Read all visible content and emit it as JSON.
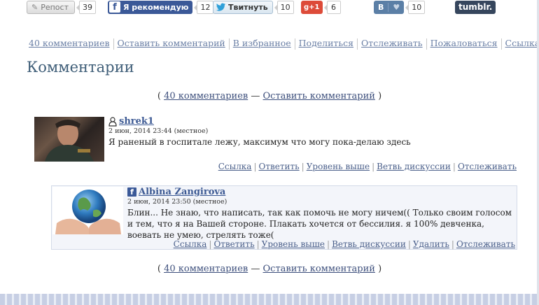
{
  "share_bar": {
    "repost": {
      "label": "Репост",
      "count": "39"
    },
    "facebook": {
      "icon": "f",
      "label": "Я рекомендую",
      "count": "12"
    },
    "twitter": {
      "label": "Твитнуть",
      "count": "10"
    },
    "gplus": {
      "label": "g+1",
      "count": "6"
    },
    "vk": {
      "icon": "В",
      "heart": "♥",
      "count": "10"
    },
    "tumblr": {
      "label": "tumblr."
    }
  },
  "toolbar": {
    "items": [
      "40 комментариев",
      "Оставить комментарий",
      "В избранное",
      "Поделиться",
      "Отслеживать",
      "Пожаловаться",
      "Ссылка"
    ]
  },
  "heading": "Комментарии",
  "comments_nav": {
    "open": "(",
    "count_link": "40 комментариев",
    "dash": "—",
    "leave_link": "Оставить комментарий",
    "close": ")"
  },
  "comments": [
    {
      "username": "shrek1",
      "date": "2 июн, 2014 23:44 (местное)",
      "text": "Я раненый в госпитале лежу, максимум что могу пока-делаю здесь",
      "actions": [
        "Ссылка",
        "Ответить",
        "Уровень выше",
        "Ветвь дискуссии",
        "Отслеживать"
      ]
    },
    {
      "username": "Albina Zangirova",
      "date": "2 июн, 2014 23:50 (местное)",
      "text": "Блин... Не знаю, что написать, так как помочь не могу ничем(( Только своим голосом и тем, что я на Вашей стороне. Плакать хочется от бессилия. я 100% девченка, воевать не умею, стрелять тоже(",
      "actions": [
        "Ссылка",
        "Ответить",
        "Уровень выше",
        "Ветвь дискуссии",
        "Удалить",
        "Отслеживать"
      ]
    }
  ],
  "colors": {
    "link": "#4a5f8a",
    "heading": "#3f5e78",
    "facebook": "#3b5998",
    "gplus": "#dd4b39",
    "vk": "#5b7fa6",
    "tumblr": "#36465d"
  }
}
